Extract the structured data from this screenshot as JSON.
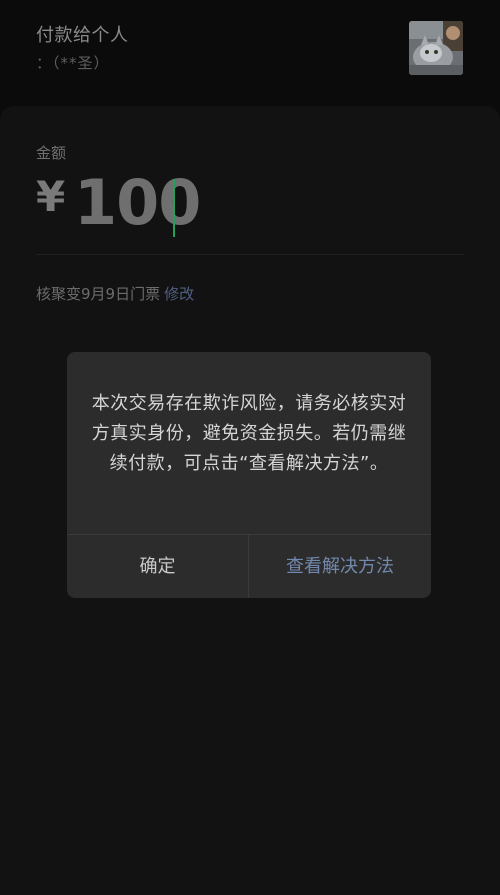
{
  "header": {
    "title": "付款给个人",
    "subtitle": "：（**圣）",
    "avatar_icon": "cat-photo-avatar"
  },
  "amount": {
    "label": "金额",
    "currency_symbol": "¥",
    "value": "100"
  },
  "note": {
    "text": "核聚变9月9日门票",
    "edit_label": "修改"
  },
  "dialog": {
    "message": "本次交易存在欺诈风险，请务必核实对方真实身份，避免资金损失。若仍需继续付款，可点击“查看解决方法”。",
    "confirm_label": "确定",
    "solution_label": "查看解决方法"
  },
  "colors": {
    "background": "#0b0b0b",
    "panel": "#121212",
    "dialog": "#2c2c2c",
    "cursor": "#1fa35a",
    "link": "#7289ad"
  }
}
